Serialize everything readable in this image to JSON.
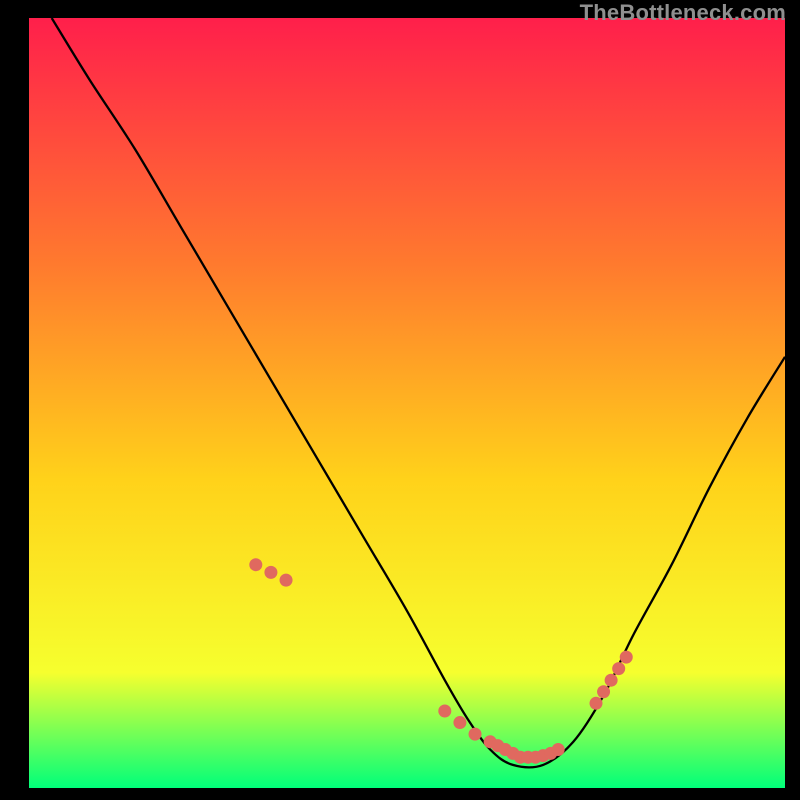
{
  "watermark": "TheBottleneck.com",
  "colors": {
    "gradient_top": "#ff1f4b",
    "gradient_mid1": "#ff7a2e",
    "gradient_mid2": "#ffd21a",
    "gradient_mid3": "#f6ff2e",
    "gradient_bottom": "#00ff7a",
    "curve": "#000000",
    "marker": "#e0695f"
  },
  "chart_data": {
    "type": "line",
    "title": "",
    "xlabel": "",
    "ylabel": "",
    "xlim": [
      0,
      100
    ],
    "ylim": [
      0,
      100
    ],
    "series": [
      {
        "name": "bottleneck-curve",
        "x": [
          3,
          8,
          14,
          20,
          26,
          32,
          38,
          44,
          50,
          55,
          58,
          61,
          64,
          68,
          72,
          76,
          80,
          85,
          90,
          95,
          100
        ],
        "y": [
          100,
          92,
          83,
          73,
          63,
          53,
          43,
          33,
          23,
          14,
          9,
          5,
          3,
          3,
          6,
          12,
          20,
          29,
          39,
          48,
          56
        ]
      }
    ],
    "markers": {
      "name": "highlight-dots",
      "x": [
        30,
        32,
        34,
        55,
        57,
        59,
        61,
        62,
        63,
        64,
        65,
        66,
        67,
        68,
        69,
        70,
        75,
        76,
        77,
        78,
        79
      ],
      "y": [
        29,
        28,
        27,
        10,
        8.5,
        7,
        6,
        5.5,
        5,
        4.5,
        4,
        4,
        4,
        4.2,
        4.5,
        5,
        11,
        12.5,
        14,
        15.5,
        17
      ]
    }
  }
}
